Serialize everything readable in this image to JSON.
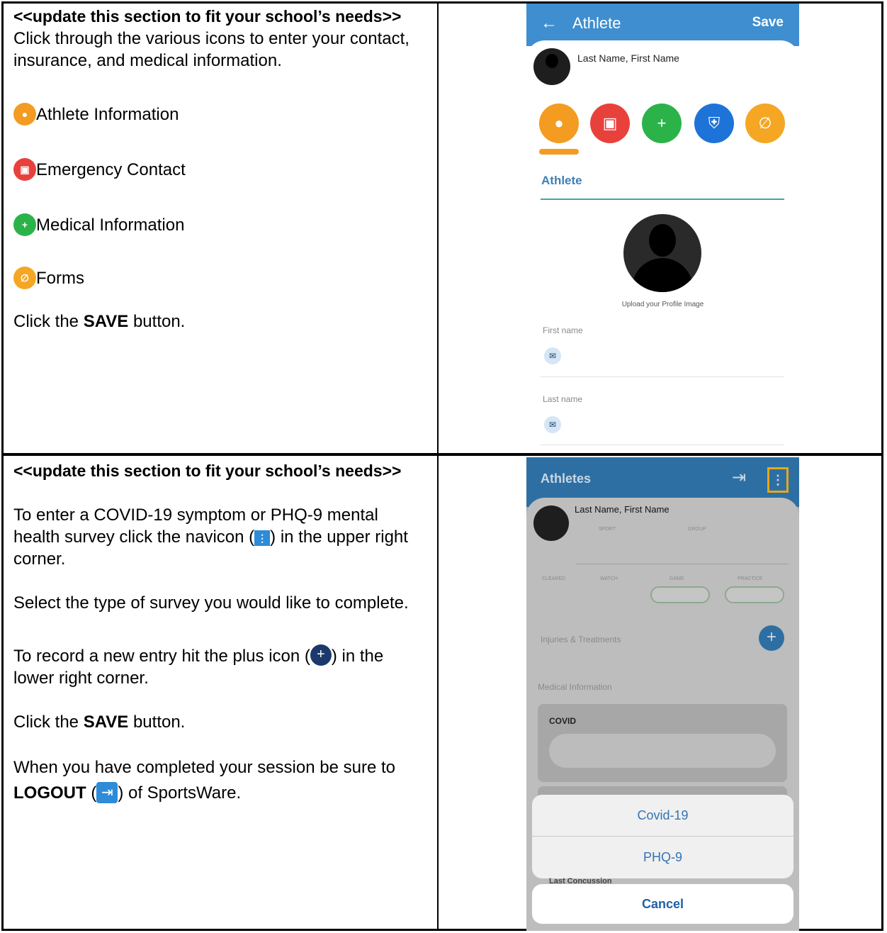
{
  "section1": {
    "header": "<<update this section to fit your school’s needs>>",
    "intro": "Click through the various icons to enter your contact, insurance, and medical information.",
    "items": [
      {
        "icon": "person-icon",
        "label": "Athlete Information",
        "color": "#f39c21"
      },
      {
        "icon": "contact-card-icon",
        "label": "Emergency Contact",
        "color": "#e8413c"
      },
      {
        "icon": "medical-book-icon",
        "label": "Medical Information",
        "color": "#2bb34a"
      },
      {
        "icon": "paperclip-icon",
        "label": "Forms",
        "color": "#f5a623"
      }
    ],
    "save_prefix": "Click the ",
    "save_bold": "SAVE",
    "save_suffix": " button."
  },
  "phone1": {
    "title": "Athlete",
    "save": "Save",
    "name": "Last Name, First Name",
    "section": "Athlete",
    "upload": "Upload your Profile Image",
    "first_name_label": "First name",
    "last_name_label": "Last name",
    "bar_color": "#3e8ed0"
  },
  "section2": {
    "header": "<<update this section to fit your school’s needs>>",
    "p1_a": "To enter a COVID-19 symptom or PHQ-9 mental health survey click the navicon (",
    "p1_b": ") in the upper right corner.",
    "p2": "Select the type of survey you would like to complete.",
    "p3_a": "To record a new entry hit the plus icon (",
    "p3_b": ") in the lower right corner.",
    "save_prefix": "Click the ",
    "save_bold": "SAVE",
    "save_suffix": " button.",
    "p5_a": "When you have completed your session be sure to ",
    "p5_bold": "LOGOUT",
    "p5_b": " (",
    "p5_c": ") of SportsWare."
  },
  "phone2": {
    "title": "Athletes",
    "name": "Last Name, First Name",
    "sport": "SPORT",
    "group": "GROUP",
    "statuses": [
      "CLEARED",
      "WATCH",
      "GAME",
      "PRACTICE"
    ],
    "injuries": "Injuries & Treatments",
    "medical_info": "Medical Information",
    "covid": "COVID",
    "option1": "Covid-19",
    "option2": "PHQ-9",
    "last_concussion": "Last Concussion",
    "cancel": "Cancel"
  }
}
